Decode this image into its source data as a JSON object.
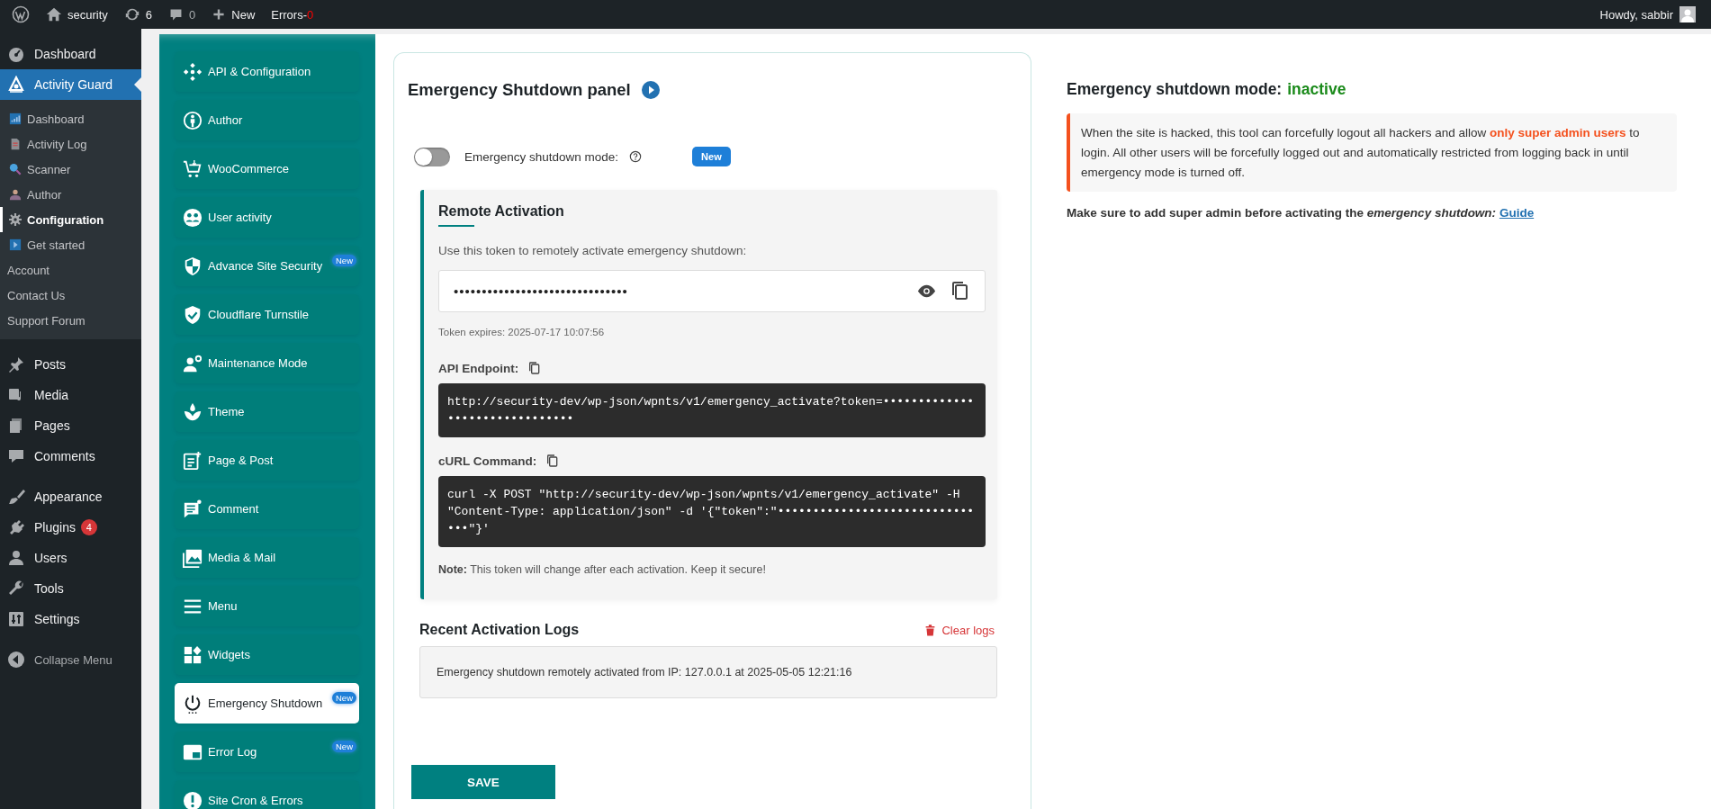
{
  "admin_bar": {
    "site": "security",
    "updates": "6",
    "comments": "0",
    "new_label": "New",
    "errors_label": "Errors-",
    "errors_count": "0",
    "greeting": "Howdy, sabbir"
  },
  "admin_menu": {
    "groups": [
      {
        "items": [
          {
            "label": "Dashboard",
            "selected": false
          },
          {
            "label": "Activity Guard",
            "selected": true,
            "children": [
              {
                "label": "Dashboard",
                "selected": false
              },
              {
                "label": "Activity Log",
                "selected": false
              },
              {
                "label": "Scanner",
                "selected": false
              },
              {
                "label": "Author",
                "selected": false
              },
              {
                "label": "Configuration",
                "selected": true
              },
              {
                "label": "Get started",
                "selected": false
              },
              {
                "label": "Account",
                "selected": false
              },
              {
                "label": "Contact Us",
                "selected": false
              },
              {
                "label": "Support Forum",
                "selected": false
              }
            ]
          }
        ]
      },
      {
        "items": [
          {
            "label": "Posts",
            "selected": false
          },
          {
            "label": "Media",
            "selected": false
          },
          {
            "label": "Pages",
            "selected": false
          },
          {
            "label": "Comments",
            "selected": false
          }
        ]
      },
      {
        "items": [
          {
            "label": "Appearance",
            "selected": false
          },
          {
            "label": "Plugins",
            "selected": false,
            "badge": "4"
          },
          {
            "label": "Users",
            "selected": false
          },
          {
            "label": "Tools",
            "selected": false
          },
          {
            "label": "Settings",
            "selected": false
          }
        ]
      }
    ],
    "collapse_label": "Collapse Menu"
  },
  "plugin_nav": [
    {
      "label": "API & Configuration",
      "selected": false
    },
    {
      "label": "Author",
      "selected": false
    },
    {
      "label": "WooCommerce",
      "selected": false
    },
    {
      "label": "User activity",
      "selected": false
    },
    {
      "label": "Advance Site Security",
      "selected": false,
      "badge": "New"
    },
    {
      "label": "Cloudflare Turnstile",
      "selected": false
    },
    {
      "label": "Maintenance Mode",
      "selected": false
    },
    {
      "label": "Theme",
      "selected": false
    },
    {
      "label": "Page & Post",
      "selected": false
    },
    {
      "label": "Comment",
      "selected": false
    },
    {
      "label": "Media & Mail",
      "selected": false
    },
    {
      "label": "Menu",
      "selected": false
    },
    {
      "label": "Widgets",
      "selected": false
    },
    {
      "label": "Emergency Shutdown",
      "selected": true,
      "badge": "New"
    },
    {
      "label": "Error Log",
      "selected": false,
      "badge": "New"
    },
    {
      "label": "Site Cron & Errors",
      "selected": false
    }
  ],
  "panel": {
    "title": "Emergency Shutdown panel",
    "toggle_label": "Emergency shutdown mode:",
    "toggle_on": false,
    "new_badge": "New",
    "remote": {
      "heading": "Remote Activation",
      "description": "Use this token to remotely activate emergency shutdown:",
      "token": "•••••••••••••••••••••••••••••••",
      "expires": "Token expires: 2025-07-17 10:07:56",
      "endpoint_label": "API Endpoint:",
      "endpoint": "http://security-dev/wp-json/wpnts/v1/emergency_activate?token=•••••••••••••••••••••••••••••••",
      "curl_label": "cURL Command:",
      "curl": "curl -X POST \"http://security-dev/wp-json/wpnts/v1/emergency_activate\" -H \"Content-Type: application/json\" -d '{\"token\":\"•••••••••••••••••••••••••••••••\"}'",
      "note": "**Note:** This token will change after each activation. Keep it secure!"
    },
    "logs": {
      "heading": "Recent Activation Logs",
      "clear_label": "Clear logs",
      "entries": [
        "Emergency shutdown remotely activated from IP: 127.0.0.1 at 2025-05-05 12:21:16"
      ]
    },
    "save_label": "SAVE"
  },
  "info": {
    "status_label": "Emergency shutdown mode:",
    "status_value": "inactive",
    "active": false,
    "alert": "When the site is hacked, this tool can forcefully logout all hackers and allow **only super admin users** to login. All other users will be forcefully logged out and automatically restricted from logging back in until emergency mode is turned off.",
    "note": "Make sure to add super admin before activating the *emergency shutdown:*",
    "link": "Guide"
  }
}
